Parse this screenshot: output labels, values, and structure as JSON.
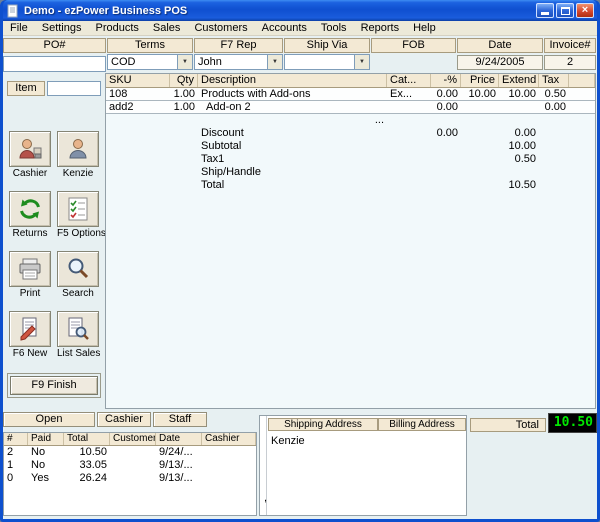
{
  "window": {
    "title": "Demo - ezPower Business POS"
  },
  "menu": {
    "items": [
      "File",
      "Settings",
      "Products",
      "Sales",
      "Customers",
      "Accounts",
      "Tools",
      "Reports",
      "Help"
    ]
  },
  "order_header": {
    "po_label": "PO#",
    "po_value": "",
    "terms_label": "Terms",
    "terms_value": "COD",
    "rep_label": "F7 Rep",
    "rep_value": "John",
    "shipvia_label": "Ship Via",
    "shipvia_value": "",
    "fob_label": "FOB",
    "fob_value": "",
    "date_label": "Date",
    "date_value": "9/24/2005",
    "invoice_label": "Invoice#",
    "invoice_value": "2"
  },
  "item_entry": {
    "label": "Item",
    "value": ""
  },
  "line_items": {
    "columns": [
      "SKU",
      "Qty",
      "Description",
      "Cat...",
      "-%",
      "Price",
      "Extend",
      "Tax"
    ],
    "rows": [
      {
        "sku": "108",
        "qty": "1.00",
        "description": "Products with Add-ons",
        "cat": "Ex...",
        "pct": "0.00",
        "price": "10.00",
        "extend": "10.00",
        "tax": "0.50"
      },
      {
        "sku": "add2",
        "qty": "1.00",
        "description": "Add-on 2",
        "cat": "",
        "pct": "0.00",
        "price": "",
        "extend": "",
        "tax": "0.00"
      }
    ],
    "more_indicator": "...",
    "summary_rows": [
      {
        "label": "Discount",
        "pct": "0.00",
        "extend": "0.00"
      },
      {
        "label": "Subtotal",
        "pct": "",
        "extend": "10.00"
      },
      {
        "label": "Tax1",
        "pct": "",
        "extend": "0.50"
      },
      {
        "label": "Ship/Handle",
        "pct": "",
        "extend": ""
      },
      {
        "label": "Total",
        "pct": "",
        "extend": "10.50"
      }
    ]
  },
  "sidebar": {
    "buttons": [
      {
        "label": "Cashier",
        "icon": "cashier-icon"
      },
      {
        "label": "Kenzie",
        "icon": "staff-person-icon"
      },
      {
        "label": "Returns",
        "icon": "returns-icon"
      },
      {
        "label": "F5 Options",
        "icon": "options-checklist-icon"
      },
      {
        "label": "Print",
        "icon": "printer-icon"
      },
      {
        "label": "Search",
        "icon": "search-icon"
      },
      {
        "label": "F6 New",
        "icon": "new-invoice-icon"
      },
      {
        "label": "List Sales",
        "icon": "list-sales-icon"
      }
    ],
    "finish_label": "F9 Finish"
  },
  "orders_panel": {
    "tabs": [
      "Open",
      "Cashier",
      "Staff"
    ],
    "columns": [
      "#",
      "Paid",
      "Total",
      "Customer",
      "Date",
      "Cashier"
    ],
    "rows": [
      {
        "num": "2",
        "paid": "No",
        "total": "10.50",
        "customer": "",
        "date": "9/24/...",
        "cashier": ""
      },
      {
        "num": "1",
        "paid": "No",
        "total": "33.05",
        "customer": "",
        "date": "9/13/...",
        "cashier": ""
      },
      {
        "num": "0",
        "paid": "Yes",
        "total": "26.24",
        "customer": "",
        "date": "9/13/...",
        "cashier": ""
      }
    ]
  },
  "address_panel": {
    "shipping_label": "Shipping Address",
    "billing_label": "Billing Address",
    "shipping_name": "Kenzie",
    "shipping_extra": ","
  },
  "total_panel": {
    "label": "Total",
    "value": "10.50"
  },
  "colors": {
    "header_tan": "#F3E9D4",
    "total_green": "#00E800",
    "total_bg": "#000000",
    "title_blue": "#0E50CE"
  }
}
